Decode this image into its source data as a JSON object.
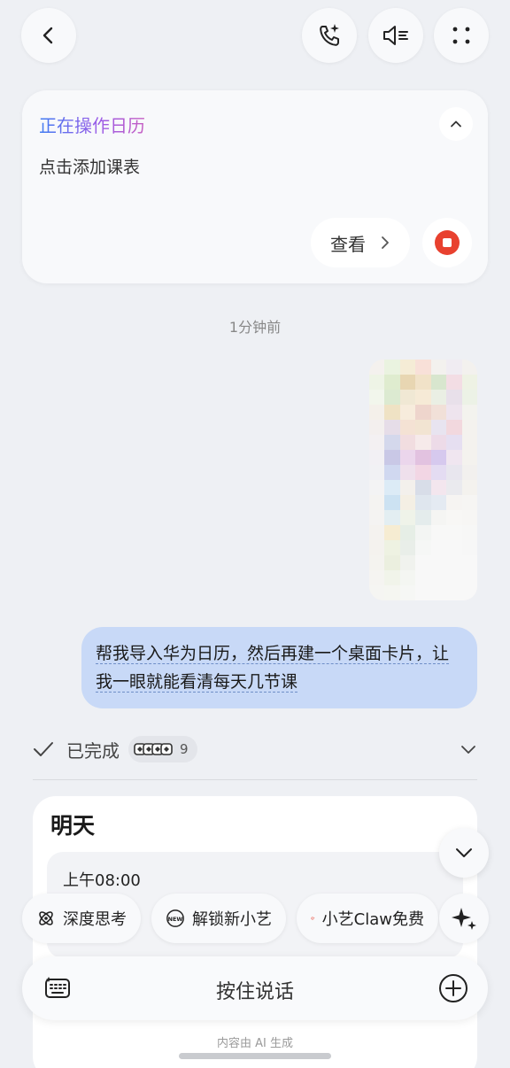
{
  "header": {
    "back_icon": "chevron-left-icon",
    "call_icon": "ai-call-icon",
    "audio_icon": "speaker-mode-icon",
    "more_icon": "more-dots-icon"
  },
  "task_card": {
    "title": "正在操作日历",
    "subtitle": "点击添加课表",
    "view_label": "查看",
    "stop_color": "#e8412f"
  },
  "conversation": {
    "timestamp": "1分钟前",
    "user_message": "帮我导入华为日历，然后再建一个桌面卡片，让我一眼就能看清每天几节课"
  },
  "status": {
    "done_label": "已完成",
    "steps_count": "9"
  },
  "result_card": {
    "title": "明天",
    "time": "上午08:00"
  },
  "chips": [
    {
      "label": "深度思考",
      "icon": "deep-think-icon"
    },
    {
      "label": "解锁新小艺",
      "icon": "new-badge-icon"
    },
    {
      "label": "小艺Claw免费",
      "icon": "claw-icon"
    }
  ],
  "input": {
    "push_to_talk": "按住说话"
  },
  "footer": {
    "note": "内容由 AI 生成"
  },
  "colors": {
    "accent_blue": "#3f7cf2",
    "bubble": "#c8d9f7",
    "stop_red": "#e8412f"
  }
}
